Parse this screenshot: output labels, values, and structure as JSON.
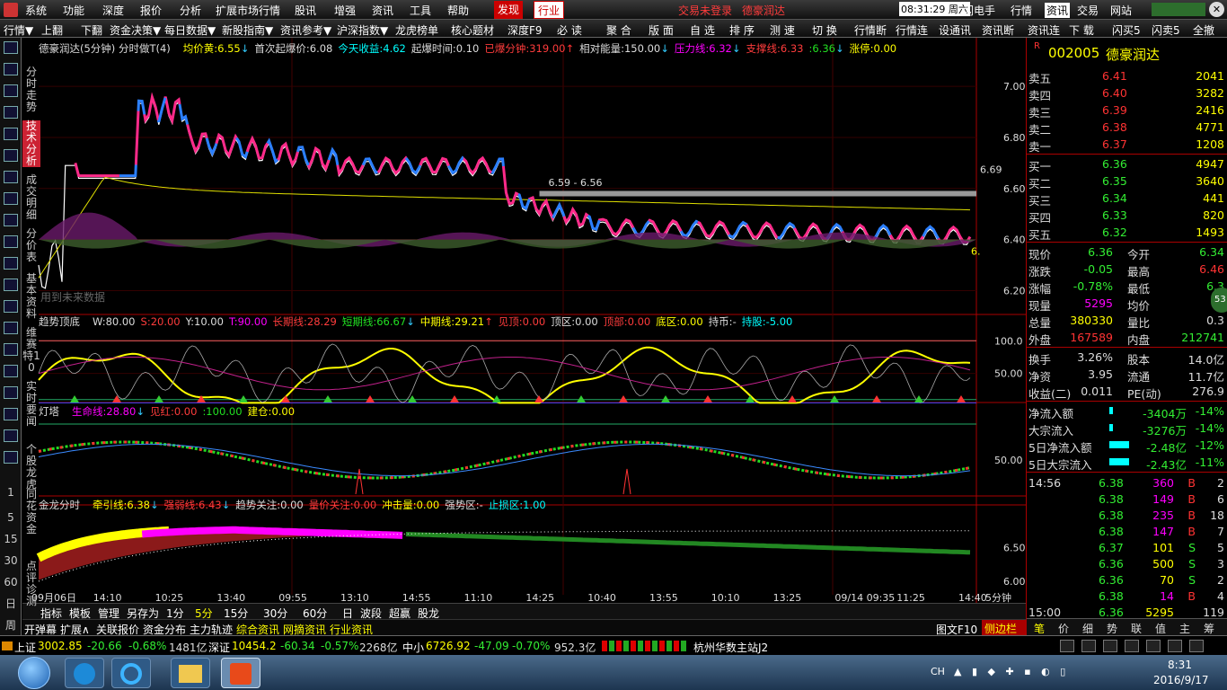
{
  "menu": {
    "items": [
      "系统",
      "功能",
      "深度",
      "报价",
      "分析",
      "扩展市场行情",
      "股讯",
      "增强",
      "资讯",
      "工具",
      "帮助"
    ],
    "tab_active": "发现",
    "tab_industry": "行业",
    "login_status": "交易未登录",
    "stock_short": "德豪润达",
    "clock": "08:31:29 周六",
    "buttons": [
      "闪电手",
      "行情",
      "资讯",
      "交易",
      "网站"
    ]
  },
  "toolbar": {
    "items": [
      "行情▼",
      "上翻",
      "下翻",
      "资金决策▼",
      "每日数据▼",
      "新股指南▼",
      "资讯参考▼",
      "沪深指数▼",
      "龙虎榜单",
      "核心题材",
      "深度F9",
      "必 读",
      "聚 合",
      "版 面",
      "自 选",
      "排 序",
      "测 速",
      "切 换",
      "行情断",
      "行情连",
      "设通讯",
      "资讯断",
      "资讯连",
      "下 载",
      "闪买5",
      "闪卖5",
      "全撤"
    ]
  },
  "leftbar": {
    "tabs": [
      "分时走势",
      "技术分析",
      "成交明细",
      "分价表",
      "基本资料",
      "维赛特10",
      "实时要闻",
      "个股龙虎",
      "同花资金",
      "点评诊测"
    ],
    "numbers": [
      "1",
      "5",
      "15",
      "30",
      "60",
      "日",
      "周"
    ]
  },
  "chart_data": [
    {
      "type": "line",
      "title": "德豪润达(5分钟) 分时做T(4)",
      "indicators": [
        {
          "label": "均价黄:",
          "value": "6.55",
          "arrow": "↓"
        },
        {
          "label": "首次起爆价:",
          "value": "6.08"
        },
        {
          "label": "今天收益:",
          "value": "4.62"
        },
        {
          "label": "起爆时间:",
          "value": "0.10"
        },
        {
          "label": "已爆分钟:",
          "value": "319.00",
          "arrow": "↑"
        },
        {
          "label": "相对能量:",
          "value": "150.00",
          "arrow": "↓"
        },
        {
          "label": "压力线:",
          "value": "6.32",
          "arrow": "↓"
        },
        {
          "label": "支撑线:",
          "value": "6.33"
        },
        {
          "label": ":",
          "value": "6.36",
          "arrow": "↓"
        },
        {
          "label": "涨停:",
          "value": "0.00"
        }
      ],
      "y_ticks": [
        "7.00",
        "6.80",
        "6.60",
        "6.40",
        "6.20"
      ],
      "ylim": [
        6.12,
        7.12
      ],
      "annotation": "6.59 - 6.56",
      "last_label": "6.69",
      "right_cut": "6.",
      "watermark": "用到未来数据"
    },
    {
      "type": "line",
      "title": "趋势顶底",
      "indicators": [
        {
          "label": "W:",
          "value": "80.00"
        },
        {
          "label": "S:",
          "value": "20.00"
        },
        {
          "label": "Y:",
          "value": "10.00"
        },
        {
          "label": "T:",
          "value": "90.00"
        },
        {
          "label": "长期线:",
          "value": "28.29"
        },
        {
          "label": "短期线:",
          "value": "66.67",
          "arrow": "↓"
        },
        {
          "label": "中期线:",
          "value": "29.21",
          "arrow": "↑"
        },
        {
          "label": "见顶:",
          "value": "0.00"
        },
        {
          "label": "顶区:",
          "value": "0.00"
        },
        {
          "label": "顶部:",
          "value": "0.00"
        },
        {
          "label": "底区:",
          "value": "0.00"
        },
        {
          "label": "持币:",
          "value": "-"
        },
        {
          "label": "持股:",
          "value": "-5.00"
        }
      ],
      "y_ticks": [
        "100.0",
        "50.00"
      ],
      "ylim": [
        0,
        110
      ]
    },
    {
      "type": "line",
      "title": "灯塔",
      "indicators": [
        {
          "label": "生命线:",
          "value": "28.80",
          "arrow": "↓"
        },
        {
          "label": "见红:",
          "value": "0.00"
        },
        {
          "label": "",
          "value": ":100.00"
        },
        {
          "label": "建仓:",
          "value": "0.00"
        }
      ],
      "y_ticks": [
        "50.00"
      ],
      "ylim": [
        0,
        100
      ]
    },
    {
      "type": "area",
      "title": "金龙分时",
      "indicators": [
        {
          "label": "牵引线:",
          "value": "6.38",
          "arrow": "↓"
        },
        {
          "label": "强弱线:",
          "value": "6.43",
          "arrow": "↓"
        },
        {
          "label": "趋势关注:",
          "value": "0.00"
        },
        {
          "label": "量价关注:",
          "value": "0.00"
        },
        {
          "label": "冲击量:",
          "value": "0.00"
        },
        {
          "label": "强势区:",
          "value": "-"
        },
        {
          "label": "止损区:",
          "value": "1.00"
        }
      ],
      "y_ticks": [
        "6.50",
        "6.00"
      ],
      "ylim": [
        5.8,
        7.0
      ]
    }
  ],
  "x_axis": {
    "labels": [
      "09月06日",
      "14:10",
      "10:25",
      "13:40",
      "09:55",
      "13:10",
      "14:55",
      "11:10",
      "14:25",
      "10:40",
      "13:55",
      "10:10",
      "13:25",
      "09/14 09:35",
      "11:25",
      "14:40"
    ],
    "period": "5分钟"
  },
  "bottom_tabs": [
    "指标",
    "模板",
    "管理",
    "另存为",
    "1分",
    "5分",
    "15分",
    "30分",
    "60分",
    "日",
    "波段",
    "超赢",
    "股龙"
  ],
  "bottom_tabs2": [
    "开弹幕",
    "扩展∧",
    "关联报价",
    "资金分布",
    "主力轨迹",
    "综合资讯",
    "网摘资讯",
    "行业资讯"
  ],
  "right_tools": [
    "图文F10",
    "侧边栏<"
  ],
  "quote": {
    "code": "002005",
    "name": "德豪润达",
    "asks": [
      {
        "label": "卖五",
        "price": "6.41",
        "vol": "2041"
      },
      {
        "label": "卖四",
        "price": "6.40",
        "vol": "3282"
      },
      {
        "label": "卖三",
        "price": "6.39",
        "vol": "2416"
      },
      {
        "label": "卖二",
        "price": "6.38",
        "vol": "4771"
      },
      {
        "label": "卖一",
        "price": "6.37",
        "vol": "1208"
      }
    ],
    "bids": [
      {
        "label": "买一",
        "price": "6.36",
        "vol": "4947"
      },
      {
        "label": "买二",
        "price": "6.35",
        "vol": "3640"
      },
      {
        "label": "买三",
        "price": "6.34",
        "vol": "441"
      },
      {
        "label": "买四",
        "price": "6.33",
        "vol": "820"
      },
      {
        "label": "买五",
        "price": "6.32",
        "vol": "1493"
      }
    ],
    "stats": [
      {
        "l1": "现价",
        "v1": "6.36",
        "l2": "今开",
        "v2": "6.34"
      },
      {
        "l1": "涨跌",
        "v1": "-0.05",
        "l2": "最高",
        "v2": "6.46"
      },
      {
        "l1": "涨幅",
        "v1": "-0.78%",
        "l2": "最低",
        "v2": "6.3"
      },
      {
        "l1": "现量",
        "v1": "5295",
        "l2": "均价",
        "v2": "6"
      },
      {
        "l1": "总量",
        "v1": "380330",
        "l2": "量比",
        "v2": "0.3"
      },
      {
        "l1": "外盘",
        "v1": "167589",
        "l2": "内盘",
        "v2": "212741"
      },
      {
        "l1": "换手",
        "v1": "3.26%",
        "l2": "股本",
        "v2": "14.0亿"
      },
      {
        "l1": "净资",
        "v1": "3.95",
        "l2": "流通",
        "v2": "11.7亿"
      },
      {
        "l1": "收益(二)",
        "v1": "0.011",
        "l2": "PE(动)",
        "v2": "276.9"
      }
    ],
    "flows": [
      {
        "label": "净流入额",
        "value": "-3404万",
        "pct": "-14%"
      },
      {
        "label": "大宗流入",
        "value": "-3276万",
        "pct": "-14%"
      },
      {
        "label": "5日净流入额",
        "value": "-2.48亿",
        "pct": "-12%"
      },
      {
        "label": "5日大宗流入",
        "value": "-2.43亿",
        "pct": "-11%"
      }
    ],
    "ticks": [
      {
        "t": "14:56",
        "p": "6.38",
        "v": "360",
        "s": "B",
        "n": "2"
      },
      {
        "t": "",
        "p": "6.38",
        "v": "149",
        "s": "B",
        "n": "6"
      },
      {
        "t": "",
        "p": "6.38",
        "v": "235",
        "s": "B",
        "n": "18"
      },
      {
        "t": "",
        "p": "6.38",
        "v": "147",
        "s": "B",
        "n": "7"
      },
      {
        "t": "",
        "p": "6.37",
        "v": "101",
        "s": "S",
        "n": "5"
      },
      {
        "t": "",
        "p": "6.36",
        "v": "500",
        "s": "S",
        "n": "3"
      },
      {
        "t": "",
        "p": "6.36",
        "v": "70",
        "s": "S",
        "n": "2"
      },
      {
        "t": "",
        "p": "6.38",
        "v": "14",
        "s": "B",
        "n": "4"
      },
      {
        "t": "15:00",
        "p": "6.36",
        "v": "5295",
        "s": "",
        "n": "119"
      }
    ],
    "bottom_tabs": [
      "笔",
      "价",
      "细",
      "势",
      "联",
      "值",
      "主",
      "筹"
    ],
    "badge": "53"
  },
  "status": {
    "sh_label": "上证",
    "sh": "3002.85",
    "sh_chg": "-20.66",
    "sh_pct": "-0.68%",
    "sh_amt": "1481亿",
    "sz_label": "深证",
    "sz": "10454.2",
    "sz_chg": "-60.34",
    "sz_pct": "-0.57%",
    "sz_amt": "2268亿",
    "zx_label": "中小",
    "zx": "6726.92",
    "zx_chg": "-47.09",
    "zx_pct": "-0.70%",
    "zx_amt": "952.3亿",
    "server": "杭州华数主站J2"
  },
  "taskbar": {
    "lang": "CH",
    "time": "8:31",
    "date": "2016/9/17"
  },
  "colors": {
    "up": "#ff3c3c",
    "down": "#22e022",
    "text_yellow": "#ffff00",
    "accent_cyan": "#00ffff",
    "grid_red": "#8b0000"
  }
}
